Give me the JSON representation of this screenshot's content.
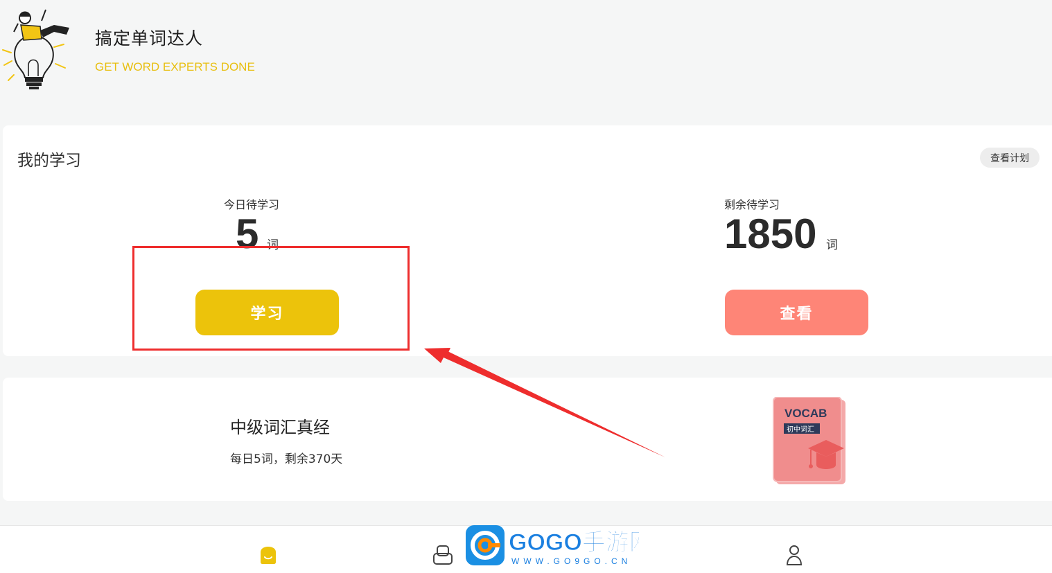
{
  "header": {
    "title": "搞定单词达人",
    "subtitle": "GET WORD EXPERTS DONE"
  },
  "study": {
    "section_title": "我的学习",
    "view_plan_label": "查看计划",
    "today": {
      "label": "今日待学习",
      "count": "5",
      "unit": "词"
    },
    "remaining": {
      "label": "剩余待学习",
      "count": "1850",
      "unit": "词"
    },
    "study_button_label": "学习",
    "view_button_label": "查看"
  },
  "book": {
    "title": "中级词汇真经",
    "meta": "每日5词，剩余370天",
    "cover_title": "VOCAB",
    "cover_subtitle": "初中词汇"
  },
  "nav": {
    "items": [
      {
        "icon": "home-icon",
        "active": true
      },
      {
        "icon": "word-list-icon",
        "active": false
      },
      {
        "icon": "profile-icon",
        "active": false
      }
    ]
  },
  "watermark": {
    "brand": "GOGO手游网",
    "url": "WWW.GO9GO.CN"
  },
  "colors": {
    "accent_yellow": "#ecc30b",
    "accent_coral": "#fe8577",
    "highlight_red": "#ee2d2d",
    "background": "#f5f6f6"
  }
}
